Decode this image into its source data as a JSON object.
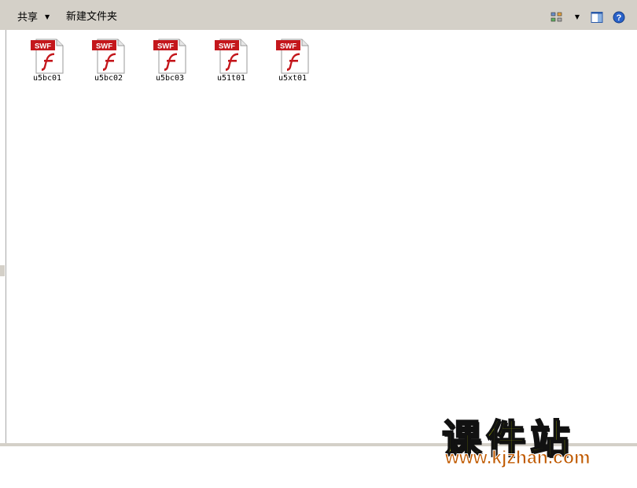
{
  "toolbar": {
    "share_label": "共享",
    "new_folder_label": "新建文件夹"
  },
  "icons": {
    "view": "view-options-icon",
    "preview": "preview-pane-icon",
    "help": "help-icon"
  },
  "files": [
    {
      "name": "u5bc01",
      "badge": "SWF"
    },
    {
      "name": "u5bc02",
      "badge": "SWF"
    },
    {
      "name": "u5bc03",
      "badge": "SWF"
    },
    {
      "name": "u51t01",
      "badge": "SWF"
    },
    {
      "name": "u5xt01",
      "badge": "SWF"
    }
  ],
  "watermark": {
    "title": "课件站",
    "url": "www.kjzhan.com"
  },
  "colors": {
    "chrome": "#d4d0c8",
    "swf_red": "#c4171c",
    "watermark_green": "#d7ef00",
    "watermark_orange": "#c05a00"
  }
}
